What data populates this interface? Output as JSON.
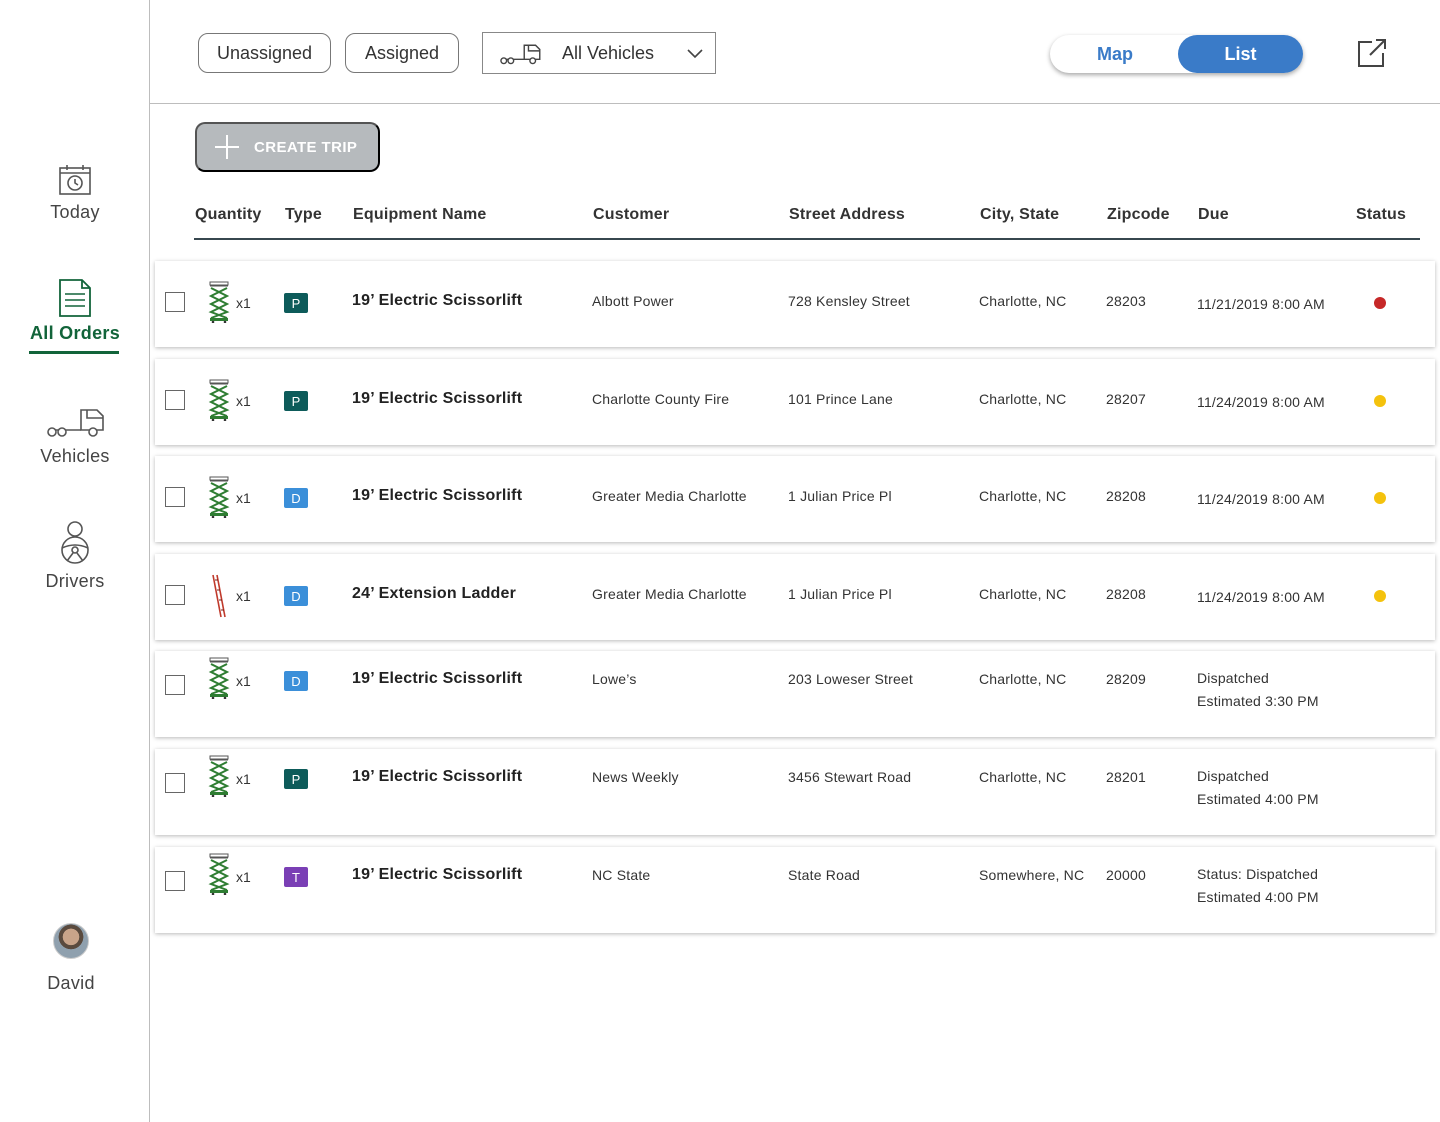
{
  "sidebar": {
    "items": [
      {
        "label": "Today",
        "icon": "calendar-clock-icon"
      },
      {
        "label": "All Orders",
        "icon": "document-icon",
        "active": true
      },
      {
        "label": "Vehicles",
        "icon": "truck-icon"
      },
      {
        "label": "Drivers",
        "icon": "steering-wheel-icon"
      }
    ],
    "user": {
      "name": "David",
      "icon": "avatar"
    }
  },
  "toolbar": {
    "unassigned_label": "Unassigned",
    "assigned_label": "Assigned",
    "vehicle_select_value": "All Vehicles",
    "map_label": "Map",
    "list_label": "List",
    "view_mode": "List",
    "popout_icon": "external-link-icon"
  },
  "create_trip_label": "CREATE TRIP",
  "table": {
    "headers": {
      "quantity": "Quantity",
      "type": "Type",
      "equipment": "Equipment Name",
      "customer": "Customer",
      "street": "Street Address",
      "city": "City, State",
      "zipcode": "Zipcode",
      "due": "Due",
      "status": "Status"
    },
    "rows": [
      {
        "qty": "x1",
        "equipment_icon": "scissorlift-icon",
        "type": "P",
        "equipment": "19’ Electric Scissorlift",
        "customer": "Albott Power",
        "street": "728 Kensley Street",
        "city": "Charlotte, NC",
        "zip": "28203",
        "due": "11/21/2019 8:00 AM",
        "due2": "",
        "status": "red"
      },
      {
        "qty": "x1",
        "equipment_icon": "scissorlift-icon",
        "type": "P",
        "equipment": "19’ Electric Scissorlift",
        "customer": "Charlotte County Fire",
        "street": "101 Prince Lane",
        "city": "Charlotte, NC",
        "zip": "28207",
        "due": "11/24/2019 8:00 AM",
        "due2": "",
        "status": "yellow"
      },
      {
        "qty": "x1",
        "equipment_icon": "scissorlift-icon",
        "type": "D",
        "equipment": "19’ Electric Scissorlift",
        "customer": "Greater Media Charlotte",
        "street": "1 Julian Price Pl",
        "city": "Charlotte, NC",
        "zip": "28208",
        "due": "11/24/2019 8:00 AM",
        "due2": "",
        "status": "yellow"
      },
      {
        "qty": "x1",
        "equipment_icon": "ladder-icon",
        "type": "D",
        "equipment": "24’ Extension Ladder",
        "customer": "Greater Media Charlotte",
        "street": "1 Julian Price Pl",
        "city": "Charlotte, NC",
        "zip": "28208",
        "due": "11/24/2019 8:00 AM",
        "due2": "",
        "status": "yellow"
      },
      {
        "qty": "x1",
        "equipment_icon": "scissorlift-icon",
        "type": "D",
        "equipment": "19’ Electric Scissorlift",
        "customer": "Lowe’s",
        "street": "203 Loweser Street",
        "city": "Charlotte, NC",
        "zip": "28209",
        "due": "Dispatched",
        "due2": "Estimated 3:30 PM",
        "status": ""
      },
      {
        "qty": "x1",
        "equipment_icon": "scissorlift-icon",
        "type": "P",
        "equipment": "19’ Electric Scissorlift",
        "customer": "News Weekly",
        "street": "3456 Stewart Road",
        "city": "Charlotte, NC",
        "zip": "28201",
        "due": "Dispatched",
        "due2": "Estimated 4:00 PM",
        "status": ""
      },
      {
        "qty": "x1",
        "equipment_icon": "scissorlift-icon",
        "type": "T",
        "equipment": "19’ Electric Scissorlift",
        "customer": "NC State",
        "street": "State Road",
        "city": "Somewhere, NC",
        "zip": "20000",
        "due": "Status: Dispatched",
        "due2": "Estimated 4:00 PM",
        "status": ""
      }
    ]
  },
  "colors": {
    "brand_green": "#12643a",
    "accent_blue": "#3a7bc8",
    "type_P": "#0d5b5a",
    "type_D": "#3b8fd9",
    "type_T": "#7a3fb5",
    "status_red": "#c62828",
    "status_yellow": "#f4c20d"
  }
}
